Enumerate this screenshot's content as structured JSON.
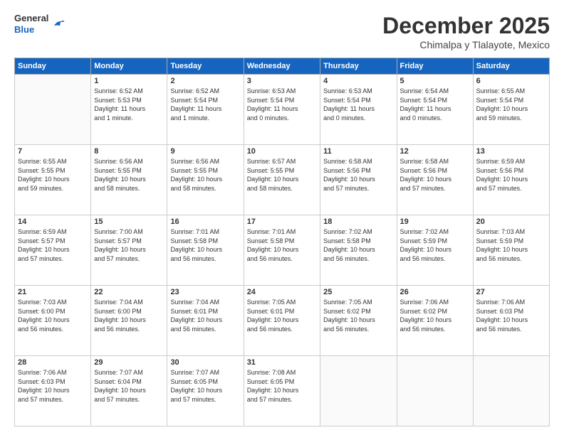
{
  "header": {
    "logo": {
      "general": "General",
      "blue": "Blue"
    },
    "title": "December 2025",
    "subtitle": "Chimalpa y Tlalayote, Mexico"
  },
  "calendar": {
    "days_of_week": [
      "Sunday",
      "Monday",
      "Tuesday",
      "Wednesday",
      "Thursday",
      "Friday",
      "Saturday"
    ],
    "weeks": [
      [
        {
          "day": "",
          "info": ""
        },
        {
          "day": "1",
          "info": "Sunrise: 6:52 AM\nSunset: 5:53 PM\nDaylight: 11 hours\nand 1 minute."
        },
        {
          "day": "2",
          "info": "Sunrise: 6:52 AM\nSunset: 5:54 PM\nDaylight: 11 hours\nand 1 minute."
        },
        {
          "day": "3",
          "info": "Sunrise: 6:53 AM\nSunset: 5:54 PM\nDaylight: 11 hours\nand 0 minutes."
        },
        {
          "day": "4",
          "info": "Sunrise: 6:53 AM\nSunset: 5:54 PM\nDaylight: 11 hours\nand 0 minutes."
        },
        {
          "day": "5",
          "info": "Sunrise: 6:54 AM\nSunset: 5:54 PM\nDaylight: 11 hours\nand 0 minutes."
        },
        {
          "day": "6",
          "info": "Sunrise: 6:55 AM\nSunset: 5:54 PM\nDaylight: 10 hours\nand 59 minutes."
        }
      ],
      [
        {
          "day": "7",
          "info": "Sunrise: 6:55 AM\nSunset: 5:55 PM\nDaylight: 10 hours\nand 59 minutes."
        },
        {
          "day": "8",
          "info": "Sunrise: 6:56 AM\nSunset: 5:55 PM\nDaylight: 10 hours\nand 58 minutes."
        },
        {
          "day": "9",
          "info": "Sunrise: 6:56 AM\nSunset: 5:55 PM\nDaylight: 10 hours\nand 58 minutes."
        },
        {
          "day": "10",
          "info": "Sunrise: 6:57 AM\nSunset: 5:55 PM\nDaylight: 10 hours\nand 58 minutes."
        },
        {
          "day": "11",
          "info": "Sunrise: 6:58 AM\nSunset: 5:56 PM\nDaylight: 10 hours\nand 57 minutes."
        },
        {
          "day": "12",
          "info": "Sunrise: 6:58 AM\nSunset: 5:56 PM\nDaylight: 10 hours\nand 57 minutes."
        },
        {
          "day": "13",
          "info": "Sunrise: 6:59 AM\nSunset: 5:56 PM\nDaylight: 10 hours\nand 57 minutes."
        }
      ],
      [
        {
          "day": "14",
          "info": "Sunrise: 6:59 AM\nSunset: 5:57 PM\nDaylight: 10 hours\nand 57 minutes."
        },
        {
          "day": "15",
          "info": "Sunrise: 7:00 AM\nSunset: 5:57 PM\nDaylight: 10 hours\nand 57 minutes."
        },
        {
          "day": "16",
          "info": "Sunrise: 7:01 AM\nSunset: 5:58 PM\nDaylight: 10 hours\nand 56 minutes."
        },
        {
          "day": "17",
          "info": "Sunrise: 7:01 AM\nSunset: 5:58 PM\nDaylight: 10 hours\nand 56 minutes."
        },
        {
          "day": "18",
          "info": "Sunrise: 7:02 AM\nSunset: 5:58 PM\nDaylight: 10 hours\nand 56 minutes."
        },
        {
          "day": "19",
          "info": "Sunrise: 7:02 AM\nSunset: 5:59 PM\nDaylight: 10 hours\nand 56 minutes."
        },
        {
          "day": "20",
          "info": "Sunrise: 7:03 AM\nSunset: 5:59 PM\nDaylight: 10 hours\nand 56 minutes."
        }
      ],
      [
        {
          "day": "21",
          "info": "Sunrise: 7:03 AM\nSunset: 6:00 PM\nDaylight: 10 hours\nand 56 minutes."
        },
        {
          "day": "22",
          "info": "Sunrise: 7:04 AM\nSunset: 6:00 PM\nDaylight: 10 hours\nand 56 minutes."
        },
        {
          "day": "23",
          "info": "Sunrise: 7:04 AM\nSunset: 6:01 PM\nDaylight: 10 hours\nand 56 minutes."
        },
        {
          "day": "24",
          "info": "Sunrise: 7:05 AM\nSunset: 6:01 PM\nDaylight: 10 hours\nand 56 minutes."
        },
        {
          "day": "25",
          "info": "Sunrise: 7:05 AM\nSunset: 6:02 PM\nDaylight: 10 hours\nand 56 minutes."
        },
        {
          "day": "26",
          "info": "Sunrise: 7:06 AM\nSunset: 6:02 PM\nDaylight: 10 hours\nand 56 minutes."
        },
        {
          "day": "27",
          "info": "Sunrise: 7:06 AM\nSunset: 6:03 PM\nDaylight: 10 hours\nand 56 minutes."
        }
      ],
      [
        {
          "day": "28",
          "info": "Sunrise: 7:06 AM\nSunset: 6:03 PM\nDaylight: 10 hours\nand 57 minutes."
        },
        {
          "day": "29",
          "info": "Sunrise: 7:07 AM\nSunset: 6:04 PM\nDaylight: 10 hours\nand 57 minutes."
        },
        {
          "day": "30",
          "info": "Sunrise: 7:07 AM\nSunset: 6:05 PM\nDaylight: 10 hours\nand 57 minutes."
        },
        {
          "day": "31",
          "info": "Sunrise: 7:08 AM\nSunset: 6:05 PM\nDaylight: 10 hours\nand 57 minutes."
        },
        {
          "day": "",
          "info": ""
        },
        {
          "day": "",
          "info": ""
        },
        {
          "day": "",
          "info": ""
        }
      ]
    ]
  }
}
